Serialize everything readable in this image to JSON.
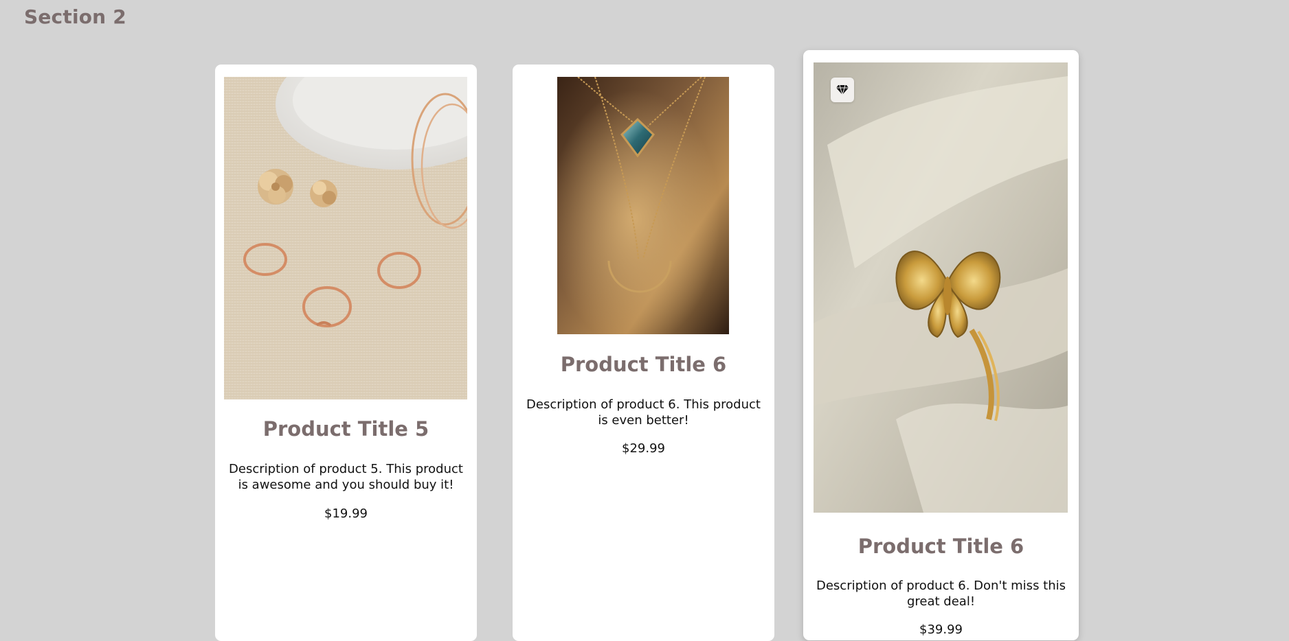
{
  "section": {
    "title": "Section 2"
  },
  "products": [
    {
      "title": "Product Title 5",
      "description": "Description of product 5. This product is awesome and you should buy it!",
      "price": "$19.99",
      "image": "jewelry-rings-earrings-photo"
    },
    {
      "title": "Product Title 6",
      "description": "Description of product 6. This product is even better!",
      "price": "$29.99",
      "image": "necklace-pendant-photo"
    },
    {
      "title": "Product Title 6",
      "description": "Description of product 6. Don't miss this great deal!",
      "price": "$39.99",
      "image": "butterfly-ring-photo",
      "badge_icon": "diamond-icon"
    }
  ],
  "colors": {
    "background": "#d3d3d3",
    "heading": "#7b6d6d",
    "card": "#ffffff",
    "text": "#111111"
  }
}
